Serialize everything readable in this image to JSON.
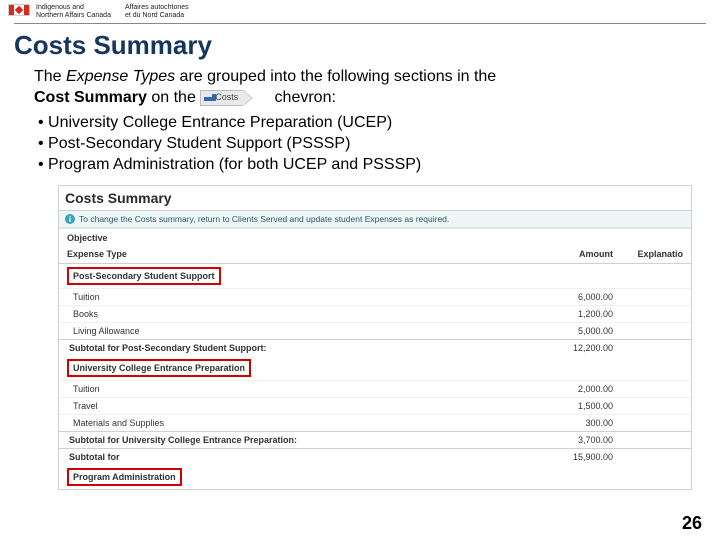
{
  "gov": {
    "en1": "Indigenous and",
    "en2": "Northern Affairs Canada",
    "fr1": "Affaires autochtones",
    "fr2": "et du Nord Canada"
  },
  "title": "Costs Summary",
  "intro": {
    "p1a": "The ",
    "p1b": "Expense Types",
    "p1c": " are grouped into the following sections in the ",
    "p2a": "Cost Summary",
    "p2b": " on the ",
    "p2c": "chevron:",
    "chevLabel": "Costs"
  },
  "bullets": [
    "University College Entrance Preparation (UCEP)",
    "Post-Secondary Student Support (PSSSP)",
    "Program Administration (for both UCEP and PSSSP)"
  ],
  "shot": {
    "heading": "Costs Summary",
    "info": "To change the Costs summary, return to Clients Served and update student Expenses as required.",
    "objective": "Objective",
    "cols": {
      "expense": "Expense Type",
      "amount": "Amount",
      "explain": "Explanatio"
    },
    "group1": {
      "label": "Post-Secondary Student Support",
      "rows": [
        {
          "n": "Tuition",
          "a": "6,000.00"
        },
        {
          "n": "Books",
          "a": "1,200.00"
        },
        {
          "n": "Living Allowance",
          "a": "5,000.00"
        }
      ],
      "subLabel": "Subtotal for Post-Secondary Student Support:",
      "subVal": "12,200.00"
    },
    "group2": {
      "label": "University College Entrance Preparation",
      "rows": [
        {
          "n": "Tuition",
          "a": "2,000.00"
        },
        {
          "n": "Travel",
          "a": "1,500.00"
        },
        {
          "n": "Materials and Supplies",
          "a": "300.00"
        }
      ],
      "subLabel": "Subtotal for University College Entrance Preparation:",
      "subVal": "3,700.00",
      "sub2Label": "Subtotal for",
      "sub2Val": "15,900.00"
    },
    "group3": {
      "label": "Program Administration"
    }
  },
  "pageNumber": "26"
}
